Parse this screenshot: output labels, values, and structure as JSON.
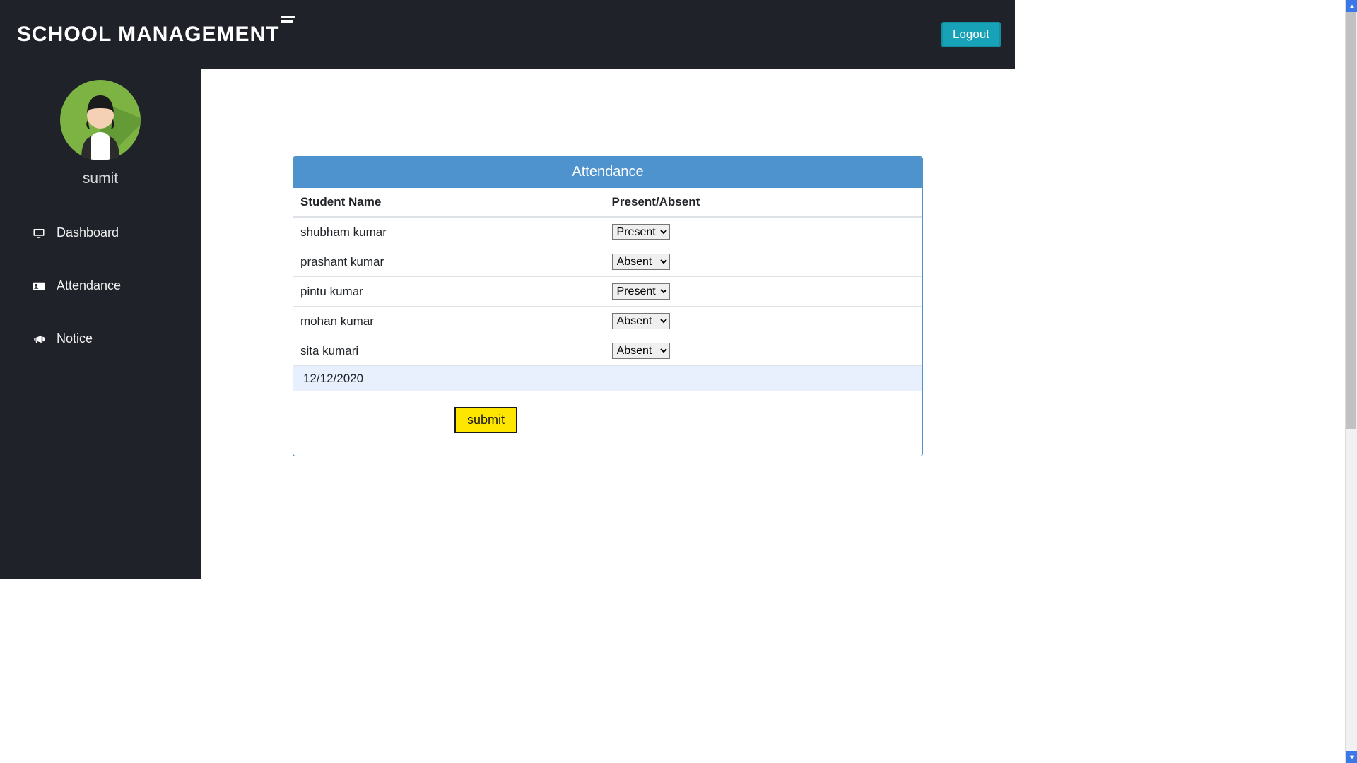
{
  "header": {
    "brand": "SCHOOL MANAGEMENT",
    "logout": "Logout"
  },
  "sidebar": {
    "username": "sumit",
    "items": [
      {
        "label": "Dashboard"
      },
      {
        "label": "Attendance"
      },
      {
        "label": "Notice"
      }
    ]
  },
  "attendance": {
    "panel_title": "Attendance",
    "col_student": "Student Name",
    "col_status": "Present/Absent",
    "options": [
      "Present",
      "Absent"
    ],
    "rows": [
      {
        "name": "shubham kumar",
        "status": "Present"
      },
      {
        "name": "prashant kumar",
        "status": "Absent"
      },
      {
        "name": "pintu kumar",
        "status": "Present"
      },
      {
        "name": "mohan kumar",
        "status": "Absent"
      },
      {
        "name": "sita kumari",
        "status": "Absent"
      }
    ],
    "date_value": "12/12/2020",
    "submit_label": "submit"
  }
}
